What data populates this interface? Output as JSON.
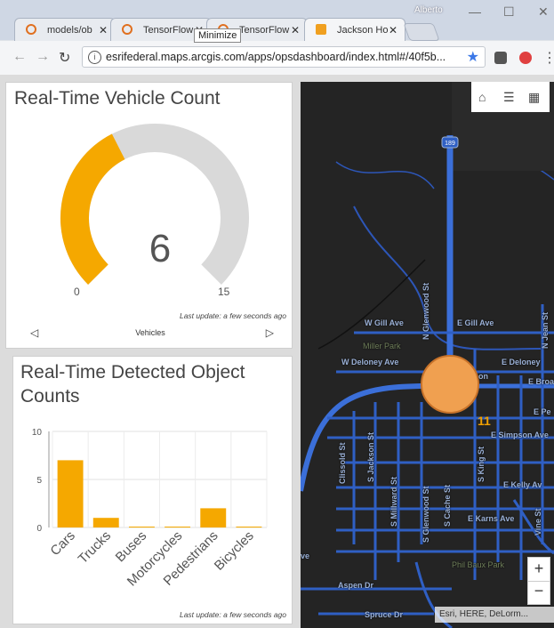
{
  "browser": {
    "tabs": [
      {
        "label": "models/ob"
      },
      {
        "label": "TensorFlow"
      },
      {
        "label": "TensorFlow"
      },
      {
        "label": "Jackson Ho"
      }
    ],
    "tab_close_glyph": "✕",
    "user": "Alberto",
    "tooltip": "Minimize",
    "url": "esrifederal.maps.arcgis.com/apps/opsdashboard/index.html#/40f5b...",
    "icons": [
      "back-icon",
      "forward-icon",
      "reload-icon",
      "info-icon",
      "star-icon"
    ]
  },
  "gauge_panel": {
    "title": "Real-Time Vehicle Count",
    "value": "6",
    "min": "0",
    "max": "15",
    "fraction": 0.4,
    "last_update": "Last update: a few seconds ago",
    "footer_label": "Vehicles",
    "colors": {
      "fill": "#f5a800",
      "track": "#d9d9d9"
    }
  },
  "chart_panel": {
    "title": "Real-Time Detected Object Counts",
    "last_update": "Last update: a few seconds ago"
  },
  "chart_data": {
    "type": "bar",
    "categories": [
      "Cars",
      "Trucks",
      "Buses",
      "Motorcycles",
      "Pedestrians",
      "Bicycles"
    ],
    "values": [
      7,
      1,
      0,
      0,
      2,
      0
    ],
    "ylim": [
      0,
      10
    ],
    "yticks": [
      "0",
      "5",
      "10"
    ],
    "grid": true,
    "color": "#f5a800"
  },
  "map": {
    "route_label": "189",
    "cluster_count": "11",
    "streets": [
      {
        "name": "W Gill Ave"
      },
      {
        "name": "E Gill Ave"
      },
      {
        "name": "W Deloney Ave"
      },
      {
        "name": "E Deloney"
      },
      {
        "name": "E Broa"
      },
      {
        "name": "E Pe"
      },
      {
        "name": "E Simpson Ave"
      },
      {
        "name": "E Kelly Av"
      },
      {
        "name": "E Karns Ave"
      },
      {
        "name": "Aspen Dr"
      },
      {
        "name": "Spruce Dr"
      },
      {
        "name": "Vine St"
      },
      {
        "name": "N Glenwood St"
      },
      {
        "name": "N Jean St"
      },
      {
        "name": "Clissold St"
      },
      {
        "name": "S Jackson St"
      },
      {
        "name": "S Millward St"
      },
      {
        "name": "S Glenwood St"
      },
      {
        "name": "S Cache St"
      },
      {
        "name": "S King St"
      },
      {
        "name": "on"
      },
      {
        "name": "ve"
      }
    ],
    "parks": [
      {
        "name": "Miller Park"
      },
      {
        "name": "Phil Baux Park"
      }
    ],
    "zoom_in": "+",
    "zoom_out": "−",
    "attribution": "Esri, HERE, DeLorm..."
  }
}
